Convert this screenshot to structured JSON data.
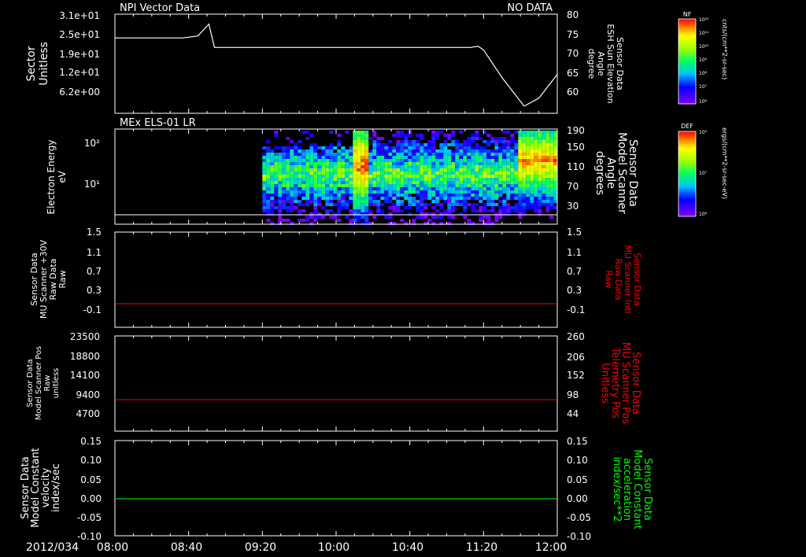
{
  "date_label": "2012/034",
  "x_ticks": [
    "08:00",
    "08:40",
    "09:20",
    "10:00",
    "10:40",
    "11:20",
    "12:00"
  ],
  "colors": {
    "white": "#ffffff",
    "red": "#ff0000",
    "green": "#00ff00",
    "bg": "#000000"
  },
  "chart_data": [
    {
      "type": "line",
      "title": "NPI Vector Data",
      "status": "NO DATA",
      "ylabel_left": [
        "Sector",
        "Unitless"
      ],
      "left_ticks": [
        "3.1e+01",
        "2.5e+01",
        "1.9e+01",
        "1.2e+01",
        "6.2e+00"
      ],
      "ylabel_right": [
        "Sensor Data",
        "ESH Sun Elevation",
        "Angle",
        "degree"
      ],
      "right_ticks": [
        "80",
        "75",
        "70",
        "65",
        "60"
      ],
      "ylim_right": [
        55,
        80
      ],
      "series": [
        {
          "axis": "right",
          "color": "#ffffff",
          "x": [
            "08:00",
            "08:37",
            "08:45",
            "08:51",
            "08:54",
            "09:20",
            "10:00",
            "10:40",
            "11:13",
            "11:17",
            "11:20",
            "11:30",
            "11:42",
            "11:50",
            "12:00"
          ],
          "y": [
            74.0,
            74.0,
            74.5,
            77.5,
            71.6,
            71.6,
            71.6,
            71.6,
            71.6,
            71.9,
            71.0,
            64.0,
            56.8,
            58.8,
            64.8
          ]
        }
      ]
    },
    {
      "type": "heatmap",
      "title": "MEx ELS-01 LR",
      "ylabel_left": [
        "Electron Energy",
        "eV"
      ],
      "left_ticks": [
        "10²",
        "10¹"
      ],
      "ylabel_right": [
        "Sensor Data",
        "Model Scanner",
        "Angle",
        "degrees"
      ],
      "right_ticks": [
        "190",
        "150",
        "110",
        "70",
        "30"
      ],
      "data_start": "09:20",
      "data_end": "12:00",
      "burst": {
        "start": "10:09",
        "end": "10:15"
      },
      "series": [
        {
          "axis": "right",
          "color": "#ffffff",
          "x": [
            "08:00",
            "12:00"
          ],
          "y": [
            10,
            10
          ]
        }
      ],
      "colorbar": {
        "label": "DEF",
        "units": "ergs/(cm**2-sr-sec-eV)",
        "ticks": [
          "10⁵",
          "10⁷",
          "10⁶"
        ]
      }
    },
    {
      "type": "line",
      "ylabel_left": [
        "Sensor Data",
        "MU Scanner +30V",
        "Raw Data",
        "Raw"
      ],
      "left_ticks": [
        "1.5",
        "1.1",
        "0.7",
        "0.3",
        "-0.1"
      ],
      "ylabel_right": [
        "Sensor Data",
        "MU Scanner Intl",
        "Raw Data",
        "Raw"
      ],
      "ylabel_right_color": "#ff0000",
      "right_ticks": [
        "1.5",
        "1.1",
        "0.7",
        "0.3",
        "-0.1"
      ],
      "series": [
        {
          "axis": "left",
          "color": "#ff0000",
          "x": [
            "08:00",
            "12:00"
          ],
          "y": [
            0.0,
            0.0
          ]
        }
      ]
    },
    {
      "type": "line",
      "ylabel_left": [
        "Sensor Data",
        "Model Scanner Pos",
        "Raw",
        "unitless"
      ],
      "left_ticks": [
        "23500",
        "18800",
        "14100",
        "9400",
        "4700"
      ],
      "ylabel_right": [
        "Sensor Data",
        "MU Scanner Pos",
        "Telemetry Pos",
        "Unitless"
      ],
      "ylabel_right_color": "#ff0000",
      "right_ticks": [
        "260",
        "206",
        "152",
        "98",
        "44"
      ],
      "series": [
        {
          "axis": "left",
          "color": "#ff0000",
          "x": [
            "08:00",
            "12:00"
          ],
          "y": [
            7900,
            7900
          ]
        }
      ]
    },
    {
      "type": "line",
      "ylabel_left": [
        "Sensor Data",
        "Model Constant",
        "velocity",
        "index/sec"
      ],
      "left_ticks": [
        "0.15",
        "0.10",
        "0.05",
        "0.00",
        "-0.05",
        "-0.10"
      ],
      "ylabel_right": [
        "Sensor Data",
        "Model Constant",
        "acceleration",
        "index/sec**2"
      ],
      "ylabel_right_color": "#00ff00",
      "right_ticks": [
        "0.15",
        "0.10",
        "0.05",
        "0.00",
        "-0.05",
        "-0.10"
      ],
      "series": [
        {
          "axis": "left",
          "color": "#00ff00",
          "x": [
            "08:00",
            "12:00"
          ],
          "y": [
            0.0,
            0.0
          ]
        }
      ]
    }
  ],
  "colorbars": [
    {
      "label": "NF",
      "units": "cnts/(cm**2-sr-sec)",
      "ticks": [
        "10¹²",
        "10¹¹",
        "10¹⁰",
        "10⁹",
        "10⁸",
        "10⁷",
        "10⁶"
      ]
    },
    {
      "label": "DEF",
      "units": "ergs/(cm**2-sr-sec-eV)",
      "ticks": [
        "10⁵",
        "10⁷",
        "10⁶"
      ]
    }
  ]
}
